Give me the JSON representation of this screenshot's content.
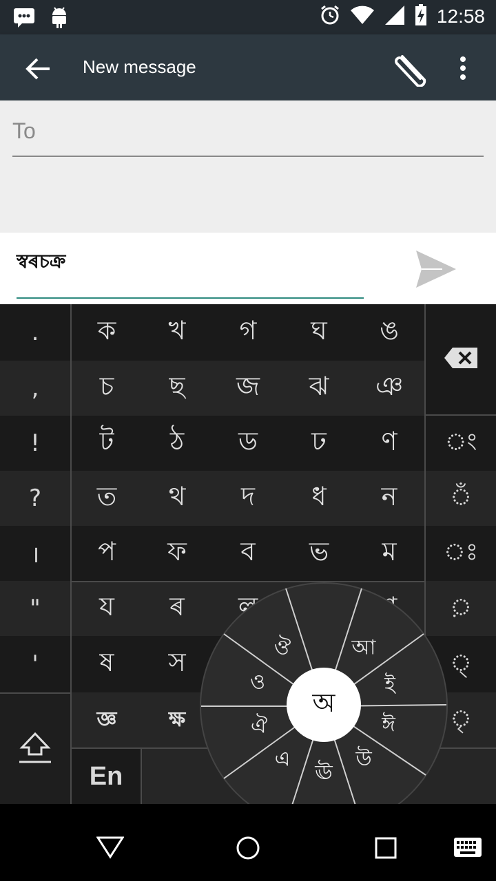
{
  "status_bar": {
    "time": "12:58",
    "left_icons": [
      "message-notification-icon",
      "android-icon"
    ],
    "right_icons": [
      "alarm-icon",
      "wifi-icon",
      "signal-icon",
      "battery-charging-icon"
    ]
  },
  "app_bar": {
    "title": "New message",
    "back_icon": "arrow-left-icon",
    "attach_icon": "paperclip-icon",
    "more_icon": "more-vert-icon"
  },
  "to_field": {
    "placeholder": "To"
  },
  "compose": {
    "text": "স্বৰচক্র",
    "send_icon": "send-icon"
  },
  "keyboard": {
    "left_column": [
      ".",
      ",",
      "!",
      "?",
      "।",
      "\"",
      "'"
    ],
    "consonant_rows": [
      [
        "ক",
        "খ",
        "গ",
        "ঘ",
        "ঙ"
      ],
      [
        "চ",
        "ছ",
        "জ",
        "ঝ",
        "ঞ"
      ],
      [
        "ট",
        "ঠ",
        "ড",
        "ঢ",
        "ণ"
      ],
      [
        "ত",
        "থ",
        "দ",
        "ধ",
        "ন"
      ],
      [
        "প",
        "ফ",
        "ব",
        "ভ",
        "ম"
      ],
      [
        "য",
        "ৰ",
        "ল",
        "শ"
      ],
      [
        "ষ",
        "স"
      ],
      [
        "জ্ঞ",
        "ক্ষ"
      ]
    ],
    "right_column": [
      "◌ং",
      "◌ঁ",
      "◌ঃ",
      "◌়",
      "◌্",
      "◌ৃ"
    ],
    "language_key": "En",
    "backspace_icon": "backspace-icon",
    "shift_icon": "shift-icon",
    "wheel_center": "অ",
    "wheel_vowels": [
      "আ",
      "ই",
      "ঈ",
      "উ",
      "ঊ",
      "এ",
      "ঐ",
      "ও",
      "ঔ"
    ]
  },
  "nav_bar": {
    "icons": [
      "back-triangle-icon",
      "home-circle-icon",
      "recents-square-icon",
      "keyboard-icon"
    ]
  },
  "colors": {
    "status_bar": "#232a30",
    "app_bar": "#2d3840",
    "accent": "#2e8b7f",
    "keyboard_bg": "#1e1e1e"
  }
}
